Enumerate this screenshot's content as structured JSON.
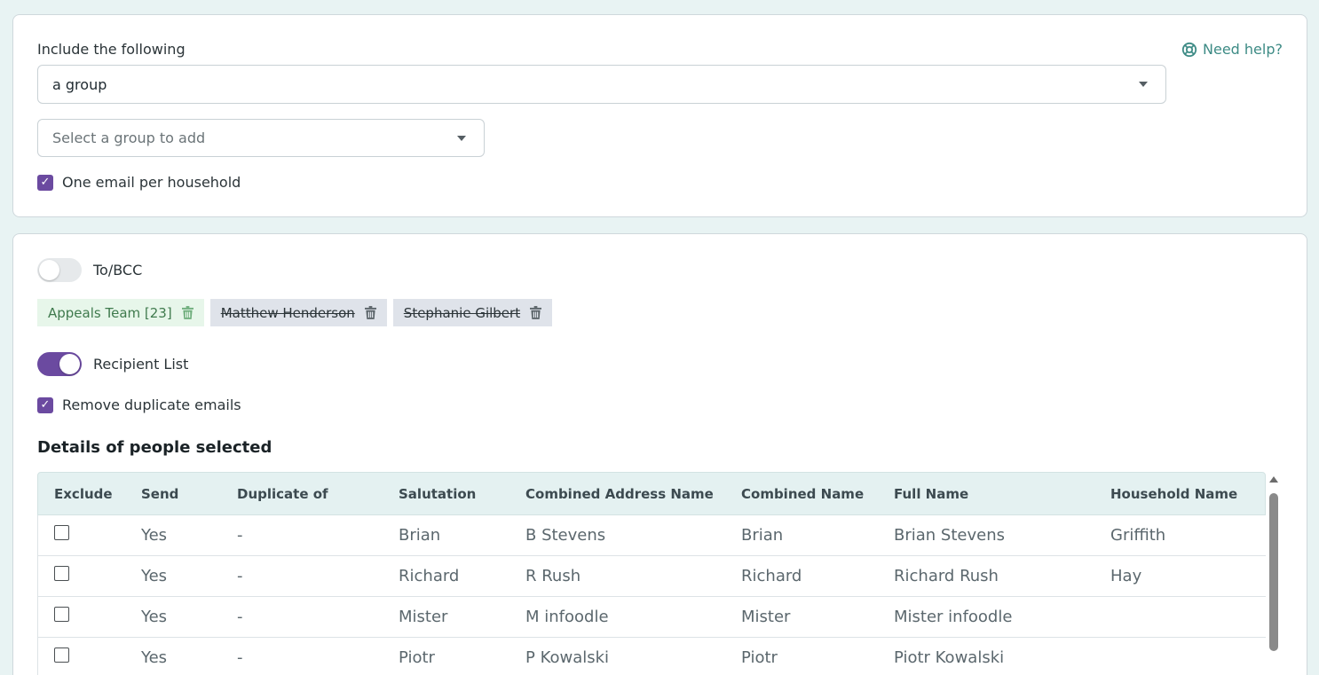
{
  "include": {
    "label": "Include the following",
    "selected_type": "a group",
    "group_placeholder": "Select a group to add",
    "one_email_label": "One email per household",
    "one_email_checked": true,
    "help_label": "Need help?"
  },
  "recipients": {
    "to_bcc_label": "To/BCC",
    "to_bcc_on": false,
    "chips": [
      {
        "label": "Appeals Team [23]",
        "state": "active"
      },
      {
        "label": "Matthew Henderson",
        "state": "removed"
      },
      {
        "label": "Stephanie Gilbert",
        "state": "removed"
      }
    ],
    "recipient_list_label": "Recipient List",
    "recipient_list_on": true,
    "remove_dup_label": "Remove duplicate emails",
    "remove_dup_checked": true
  },
  "details": {
    "title": "Details of people selected",
    "columns": [
      "Exclude",
      "Send",
      "Duplicate of",
      "Salutation",
      "Combined Address Name",
      "Combined Name",
      "Full Name",
      "Household Name"
    ],
    "rows": [
      {
        "send": "Yes",
        "duplicate_of": "-",
        "salutation": "Brian",
        "combined_address_name": "B Stevens",
        "combined_name": "Brian",
        "full_name": "Brian Stevens",
        "household_name": "Griffith"
      },
      {
        "send": "Yes",
        "duplicate_of": "-",
        "salutation": "Richard",
        "combined_address_name": "R Rush",
        "combined_name": "Richard",
        "full_name": "Richard Rush",
        "household_name": "Hay"
      },
      {
        "send": "Yes",
        "duplicate_of": "-",
        "salutation": "Mister",
        "combined_address_name": "M infoodle",
        "combined_name": "Mister",
        "full_name": "Mister infoodle",
        "household_name": ""
      },
      {
        "send": "Yes",
        "duplicate_of": "-",
        "salutation": "Piotr",
        "combined_address_name": "P Kowalski",
        "combined_name": "Piotr",
        "full_name": "Piotr Kowalski",
        "household_name": ""
      }
    ]
  },
  "colors": {
    "accent": "#6b4aa0",
    "help_link": "#3d8b85",
    "chip_active_bg": "#e7f6ea",
    "chip_removed_bg": "#dfe3ea"
  }
}
